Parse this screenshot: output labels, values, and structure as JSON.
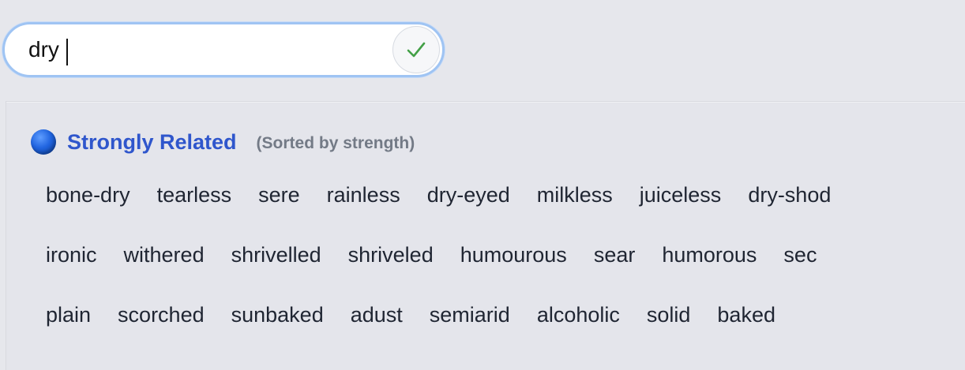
{
  "search": {
    "value": "dry"
  },
  "confirm": {
    "icon": "checkmark-icon",
    "color": "#43a047"
  },
  "section": {
    "icon": "blue-circle-icon",
    "title": "Strongly Related",
    "subtitle": "(Sorted by strength)"
  },
  "rows": [
    [
      "bone-dry",
      "tearless",
      "sere",
      "rainless",
      "dry-eyed",
      "milkless",
      "juiceless",
      "dry-shod"
    ],
    [
      "ironic",
      "withered",
      "shrivelled",
      "shriveled",
      "humourous",
      "sear",
      "humorous",
      "sec"
    ],
    [
      "plain",
      "scorched",
      "sunbaked",
      "adust",
      "semiarid",
      "alcoholic",
      "solid",
      "baked"
    ]
  ]
}
